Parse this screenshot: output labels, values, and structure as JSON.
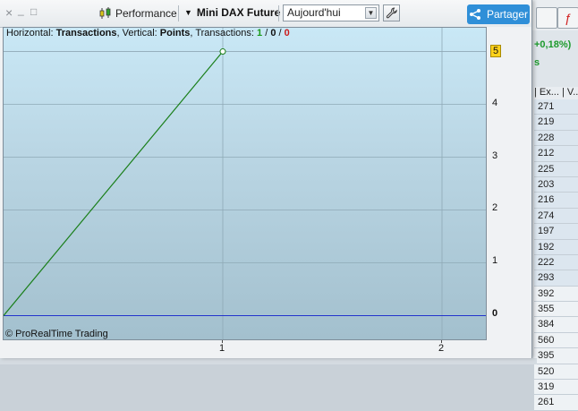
{
  "toolbar": {
    "close_glyph": "×",
    "minimize_glyph": "_",
    "maximize_glyph": "□",
    "performance_label": "Performance",
    "instrument": "Mini DAX Future",
    "period_value": "Aujourd'hui",
    "share_label": "Partager"
  },
  "chart_data": {
    "type": "line",
    "title_parts": {
      "prefix": "Horizontal: ",
      "x_name": "Transactions",
      "mid": ", Vertical: ",
      "y_name": "Points",
      "suffix": ", Transactions: ",
      "wins": "1",
      "sep1": " / ",
      "neutral": "0",
      "sep2": " / ",
      "losses": "0"
    },
    "xlabel": "Transactions",
    "ylabel": "Points",
    "x": [
      0,
      1
    ],
    "series": [
      {
        "values": [
          0,
          5
        ],
        "color": "#1a7f1a"
      }
    ],
    "baseline": {
      "value": 0,
      "color": "#2233cc"
    },
    "xlim": [
      0,
      2.2
    ],
    "ylim": [
      -0.45,
      5.45
    ],
    "x_ticks": [
      "1",
      "2"
    ],
    "y_ticks": [
      "0",
      "1",
      "2",
      "3",
      "4",
      "5"
    ],
    "last_value_label": "5",
    "grid": true
  },
  "copyright": "© ProRealTime Trading",
  "background_app": {
    "percent": "+0,18%)",
    "status": "s",
    "header": "| Ex... | V...",
    "values": [
      "271",
      "219",
      "228",
      "212",
      "225",
      "203",
      "216",
      "274",
      "197",
      "192",
      "222",
      "293",
      "392",
      "355",
      "384",
      "560",
      "395",
      "520",
      "319",
      "261"
    ]
  }
}
